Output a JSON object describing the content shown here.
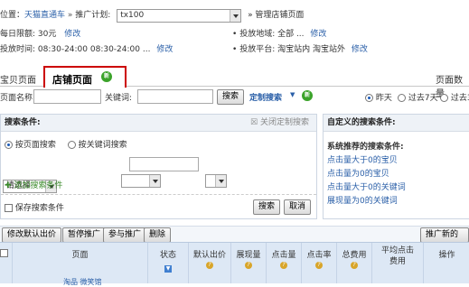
{
  "breadcrumb": {
    "prefix": "位置：",
    "home": "天猫直通车",
    "sep": " » ",
    "plan_label": "推广计划:",
    "plan_value": "tx100",
    "current": "» 管理店铺页面"
  },
  "info": {
    "daily_limit_label": "每日限额: 30元",
    "daily_limit_action": "修改",
    "time_label": "投放时间: 08:30-24:00 08:30-24:00 ...",
    "time_action": "修改",
    "region_label": "投放地域: 全部 ...",
    "region_action": "修改",
    "platform_label": "投放平台: 淘宝站内 淘宝站外",
    "platform_action": "修改"
  },
  "tabs": {
    "left": "宝贝页面",
    "active": "店铺页面",
    "new_badge": "新",
    "right": "页面数量"
  },
  "filter": {
    "page_name_label": "页面名称:",
    "keyword_label": "关键词:",
    "search_button": "搜索",
    "custom_search": "定制搜索",
    "range": [
      "昨天",
      "过去7天",
      "过去3"
    ]
  },
  "search_panel": {
    "title": "搜索条件:",
    "close_custom": "关闭定制搜索",
    "by_page": "按页面搜索",
    "by_keyword": "按关键词搜索",
    "select_placeholder": "请选择",
    "add_condition": "添加搜索条件",
    "save_condition": "保存搜索条件",
    "search_button": "搜索",
    "cancel_button": "取消"
  },
  "custom_panel": {
    "title": "自定义的搜索条件:",
    "system_title": "系统推荐的搜索条件:",
    "links": [
      "点击量大于0的宝贝",
      "点击量为0的宝贝",
      "点击量大于0的关键词",
      "展现量为0的关键词"
    ]
  },
  "actions": {
    "buttons": [
      "修改默认出价",
      "暂停推广",
      "参与推广",
      "删除"
    ],
    "right_button": "推广新的页"
  },
  "table": {
    "columns": [
      "页面",
      "状态",
      "默认出价",
      "展现量",
      "点击量",
      "点击率",
      "总费用",
      "平均点击费用",
      "操作"
    ],
    "first_row_partial": "淘品 微笑馆"
  }
}
